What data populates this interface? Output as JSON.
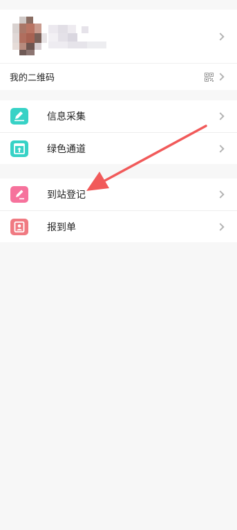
{
  "profile": {
    "chevron_icon": "chevron-right-icon"
  },
  "qr_row": {
    "label": "我的二维码",
    "icon": "qr-code-icon"
  },
  "menu_group_1": [
    {
      "label": "信息采集",
      "icon": "edit-icon",
      "color": "#37d2c6"
    },
    {
      "label": "绿色通道",
      "icon": "upload-window-icon",
      "color": "#37d2c6"
    }
  ],
  "menu_group_2": [
    {
      "label": "到站登记",
      "icon": "pencil-icon",
      "color": "#f6729c"
    },
    {
      "label": "报到单",
      "icon": "person-card-icon",
      "color": "#f07a82"
    }
  ],
  "annotation": {
    "color": "#f15a5a",
    "icon": "red-arrow-annotation"
  }
}
